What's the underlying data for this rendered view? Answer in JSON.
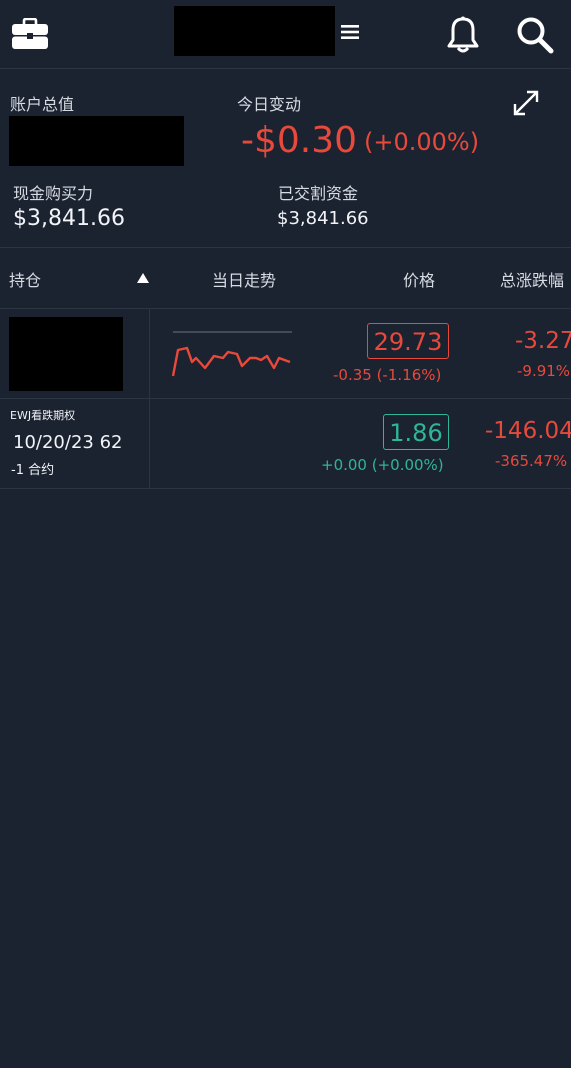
{
  "header": {
    "menu_icon": "hamburger-icon",
    "briefcase_icon": "briefcase-icon",
    "bell_icon": "bell-icon",
    "search_icon": "search-icon"
  },
  "summary": {
    "account_value_label": "账户总值",
    "day_change_label": "今日变动",
    "day_change_value": "-$0.30",
    "day_change_pct": "(+0.00%)",
    "cash_buying_power_label": "现金购买力",
    "cash_buying_power_value": "$3,841.66",
    "settled_cash_label": "已交割资金",
    "settled_cash_value": "$3,841.66",
    "expand_icon": "expand-icon"
  },
  "table": {
    "columns": {
      "position": "持仓",
      "intraday": "当日走势",
      "price": "价格",
      "total_change": "总涨跌幅"
    },
    "rows": [
      {
        "price": "29.73",
        "price_change": "-0.35 (-1.16%)",
        "total_change": "-3.27",
        "total_change_pct": "-9.91%"
      },
      {
        "name": "EWJ看跌期权",
        "expiry_strike": "10/20/23 62",
        "quantity": "-1 合约",
        "price": "1.86",
        "price_change": "+0.00 (+0.00%)",
        "total_change": "-146.04",
        "total_change_pct": "-365.47%"
      }
    ]
  },
  "colors": {
    "background": "#1b2331",
    "negative": "#e8493b",
    "positive": "#2fb59a"
  }
}
